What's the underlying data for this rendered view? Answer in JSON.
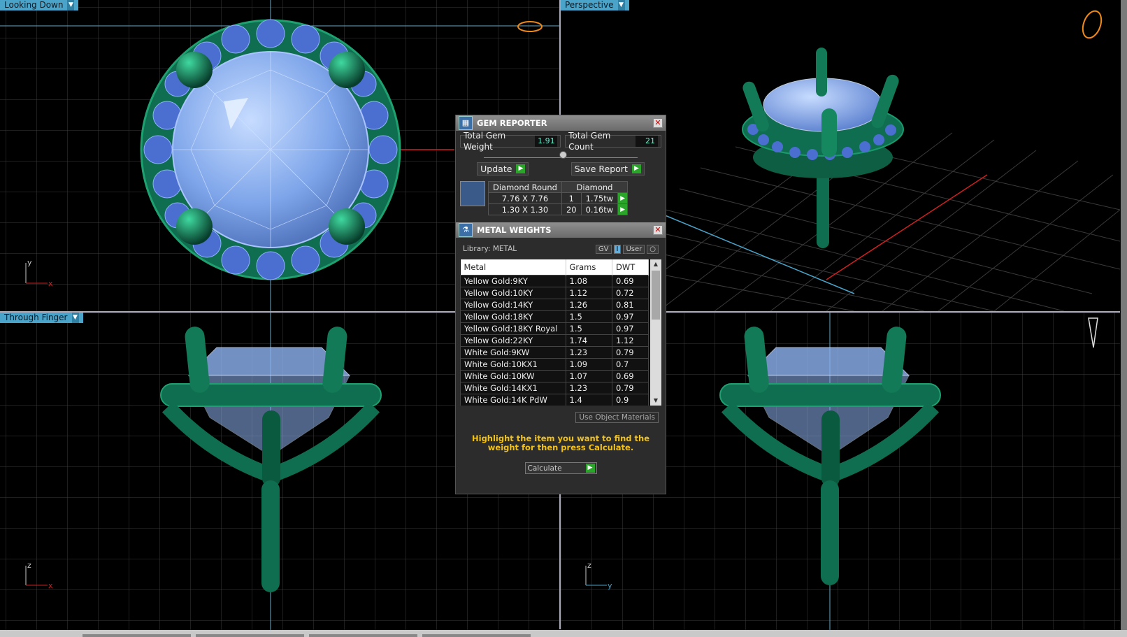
{
  "viewports": {
    "top_left": {
      "label": "Looking Down",
      "axis_a": "y",
      "axis_b": "x"
    },
    "top_right": {
      "label": "Perspective"
    },
    "bottom_left": {
      "label": "Through Finger",
      "axis_a": "z",
      "axis_b": "x"
    },
    "bottom_right": {
      "axis_a": "z",
      "axis_b": "y"
    }
  },
  "gem_reporter": {
    "title": "GEM REPORTER",
    "total_weight_label": "Total Gem Weight",
    "total_weight": "1.91",
    "total_count_label": "Total Gem Count",
    "total_count": "21",
    "update_label": "Update",
    "save_label": "Save Report",
    "table": {
      "header_shape": "Diamond Round",
      "header_type": "Diamond",
      "rows": [
        {
          "size": "7.76 X 7.76",
          "count": "1",
          "weight": "1.75tw"
        },
        {
          "size": "1.30 X 1.30",
          "count": "20",
          "weight": "0.16tw"
        }
      ]
    }
  },
  "metal_weights": {
    "title": "METAL WEIGHTS",
    "library": "Library: METAL",
    "gv_label": "GV",
    "user_label": "User",
    "columns": [
      "Metal",
      "Grams",
      "DWT"
    ],
    "rows": [
      {
        "metal": "Yellow Gold:9KY",
        "grams": "1.08",
        "dwt": "0.69"
      },
      {
        "metal": "Yellow Gold:10KY",
        "grams": "1.12",
        "dwt": "0.72"
      },
      {
        "metal": "Yellow Gold:14KY",
        "grams": "1.26",
        "dwt": "0.81"
      },
      {
        "metal": "Yellow Gold:18KY",
        "grams": "1.5",
        "dwt": "0.97"
      },
      {
        "metal": "Yellow Gold:18KY Royal",
        "grams": "1.5",
        "dwt": "0.97"
      },
      {
        "metal": "Yellow Gold:22KY",
        "grams": "1.74",
        "dwt": "1.12"
      },
      {
        "metal": "White Gold:9KW",
        "grams": "1.23",
        "dwt": "0.79"
      },
      {
        "metal": "White Gold:10KX1",
        "grams": "1.09",
        "dwt": "0.7"
      },
      {
        "metal": "White Gold:10KW",
        "grams": "1.07",
        "dwt": "0.69"
      },
      {
        "metal": "White Gold:14KX1",
        "grams": "1.23",
        "dwt": "0.79"
      },
      {
        "metal": "White Gold:14K PdW",
        "grams": "1.4",
        "dwt": "0.9"
      }
    ],
    "use_object_materials": "Use Object Materials",
    "hint": "Highlight the item you want to find the weight for then press Calculate.",
    "calculate_label": "Calculate"
  },
  "colors": {
    "grid": "#3a3a3a",
    "gem": "#8fb4f2",
    "metal": "#0f6e4f",
    "hint": "#f2c21a",
    "go_button": "#2aa52a"
  }
}
